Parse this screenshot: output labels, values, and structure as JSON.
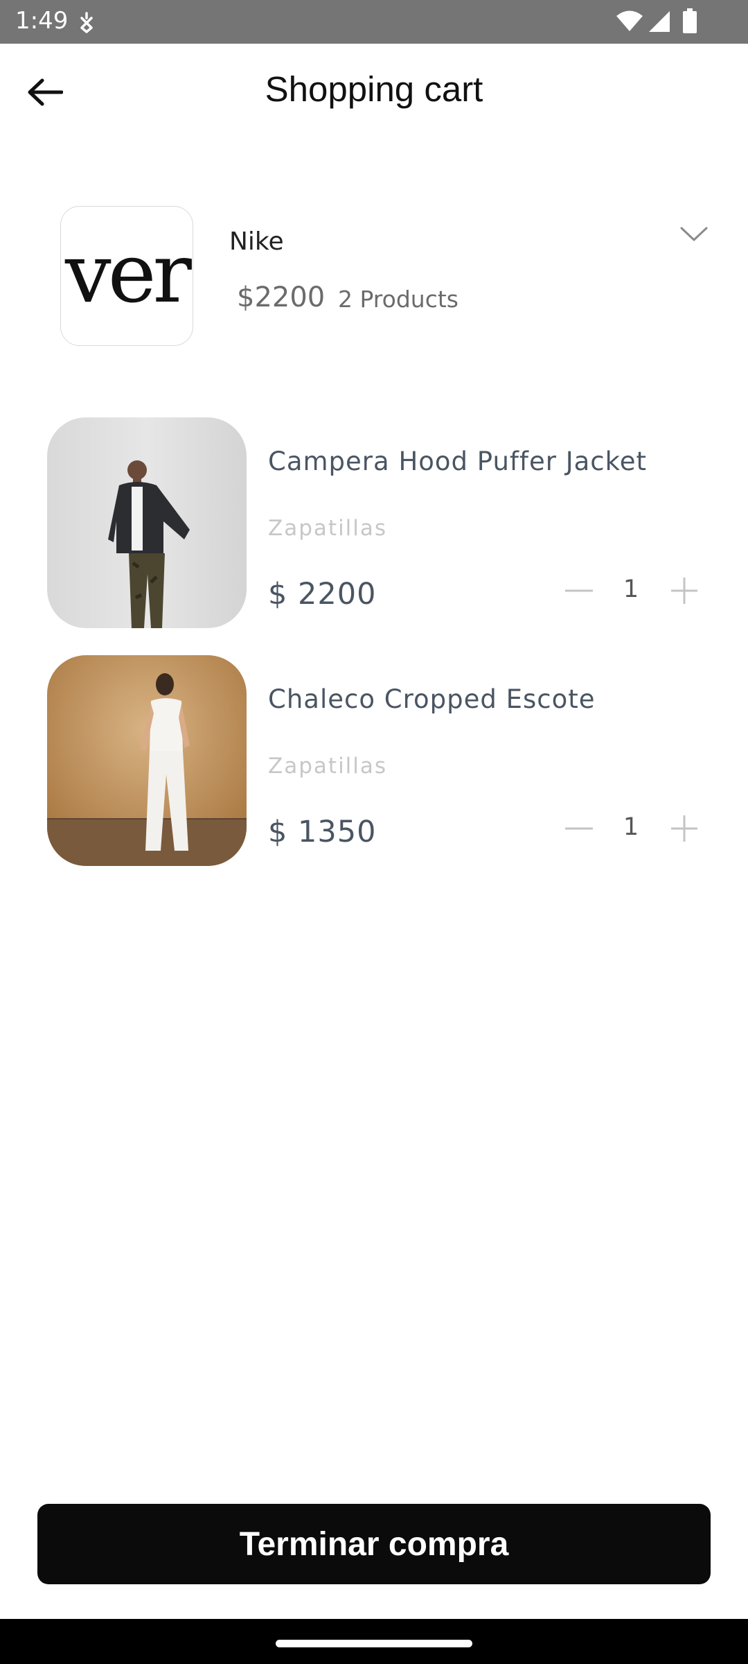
{
  "status_bar": {
    "time": "1:49",
    "icons": [
      "assistant-icon",
      "wifi-icon",
      "signal-icon",
      "battery-icon"
    ]
  },
  "header": {
    "title": "Shopping cart",
    "back_icon": "arrow-left-icon"
  },
  "store": {
    "logo_text": "ver",
    "name": "Nike",
    "total": "$2200",
    "count": "2 Products",
    "expand_icon": "chevron-down-icon"
  },
  "items": [
    {
      "name": "Campera Hood Puffer Jacket",
      "category": "Zapatillas",
      "price": "$ 2200",
      "quantity": "1"
    },
    {
      "name": "Chaleco Cropped Escote",
      "category": "Zapatillas",
      "price": "$ 1350",
      "quantity": "1"
    }
  ],
  "checkout": {
    "label": "Terminar compra"
  },
  "colors": {
    "status_bar": "#757575",
    "text_primary": "#111111",
    "text_item": "#4a5563",
    "text_muted": "#c7c7c7",
    "button": "#0b0b0b"
  }
}
